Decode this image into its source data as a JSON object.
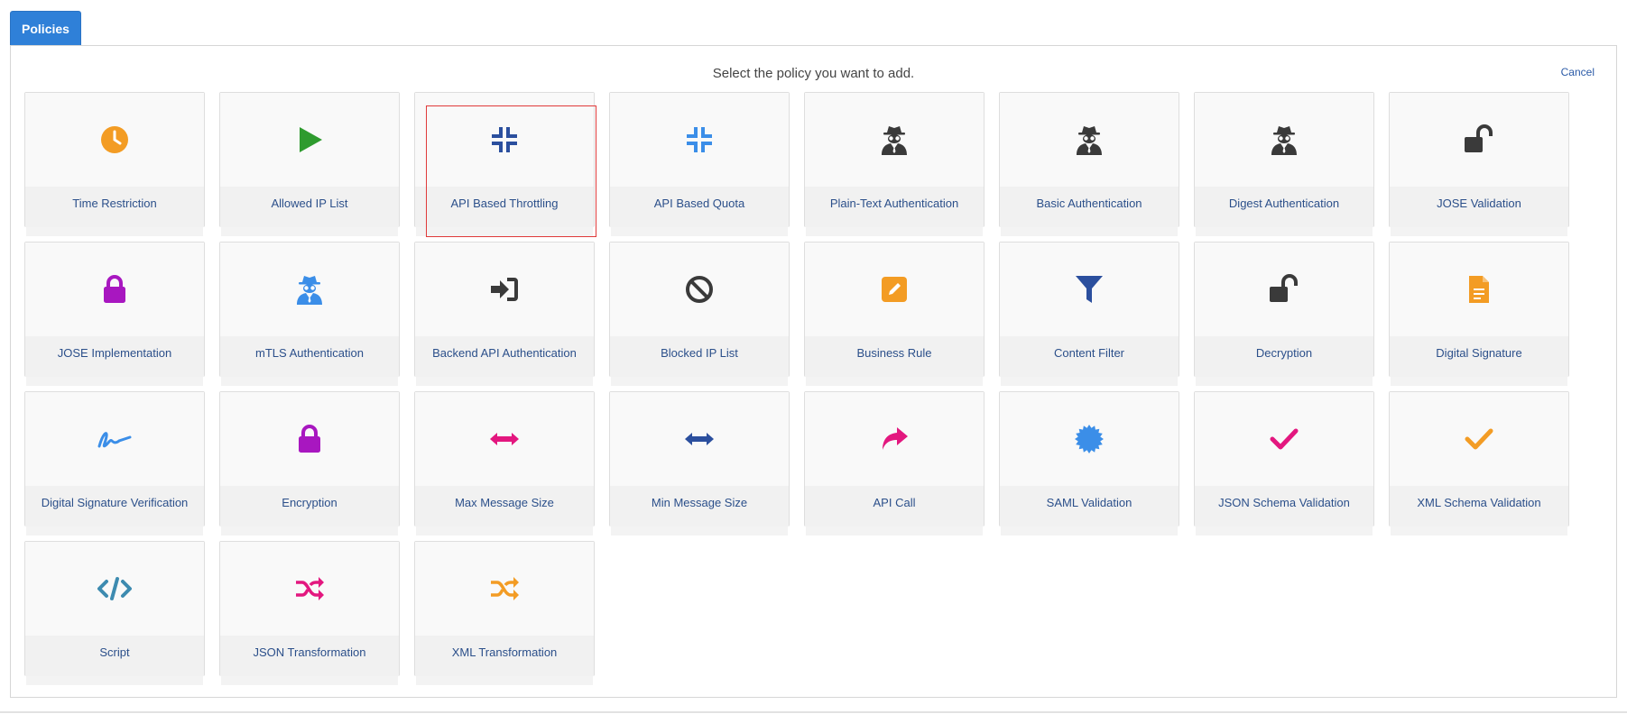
{
  "tab": {
    "label": "Policies"
  },
  "header": {
    "instruction": "Select the policy you want to add.",
    "cancel_label": "Cancel"
  },
  "policies": [
    {
      "label": "Time Restriction",
      "icon": "clock-icon",
      "color": "#f39c24"
    },
    {
      "label": "Allowed IP List",
      "icon": "play-icon",
      "color": "#2e9b2e"
    },
    {
      "label": "API Based Throttling",
      "icon": "compress-icon",
      "color": "#2b4f9e",
      "selected": true
    },
    {
      "label": "API Based Quota",
      "icon": "compress-icon",
      "color": "#3b8ee8"
    },
    {
      "label": "Plain-Text Authentication",
      "icon": "user-secret-icon",
      "color": "#3a3a3a"
    },
    {
      "label": "Basic Authentication",
      "icon": "user-secret-icon",
      "color": "#3a3a3a"
    },
    {
      "label": "Digest Authentication",
      "icon": "user-secret-icon",
      "color": "#3a3a3a"
    },
    {
      "label": "JOSE Validation",
      "icon": "unlock-icon",
      "color": "#3a3a3a"
    },
    {
      "label": "JOSE Implementation",
      "icon": "lock-icon",
      "color": "#a817c0"
    },
    {
      "label": "mTLS Authentication",
      "icon": "user-secret-icon",
      "color": "#3b8ee8"
    },
    {
      "label": "Backend API Authentication",
      "icon": "sign-in-icon",
      "color": "#3a3a3a"
    },
    {
      "label": "Blocked IP List",
      "icon": "ban-icon",
      "color": "#3a3a3a"
    },
    {
      "label": "Business Rule",
      "icon": "edit-icon",
      "color": "#f39c24"
    },
    {
      "label": "Content Filter",
      "icon": "filter-icon",
      "color": "#2b4f9e"
    },
    {
      "label": "Decryption",
      "icon": "unlock-icon",
      "color": "#3a3a3a"
    },
    {
      "label": "Digital Signature",
      "icon": "file-icon",
      "color": "#f39c24"
    },
    {
      "label": "Digital Signature Verification",
      "icon": "signature-icon",
      "color": "#3b8ee8"
    },
    {
      "label": "Encryption",
      "icon": "lock-icon",
      "color": "#a817c0"
    },
    {
      "label": "Max Message Size",
      "icon": "arrows-h-icon",
      "color": "#e3177f"
    },
    {
      "label": "Min Message Size",
      "icon": "arrows-h-icon",
      "color": "#2b4f9e"
    },
    {
      "label": "API Call",
      "icon": "share-icon",
      "color": "#e3177f"
    },
    {
      "label": "SAML Validation",
      "icon": "certificate-icon",
      "color": "#3b8ee8"
    },
    {
      "label": "JSON Schema Validation",
      "icon": "check-icon",
      "color": "#e3177f"
    },
    {
      "label": "XML Schema Validation",
      "icon": "check-icon",
      "color": "#f39c24"
    },
    {
      "label": "Script",
      "icon": "code-icon",
      "color": "#3d8bb0"
    },
    {
      "label": "JSON Transformation",
      "icon": "random-icon",
      "color": "#e3177f"
    },
    {
      "label": "XML Transformation",
      "icon": "random-icon",
      "color": "#f39c24"
    }
  ]
}
